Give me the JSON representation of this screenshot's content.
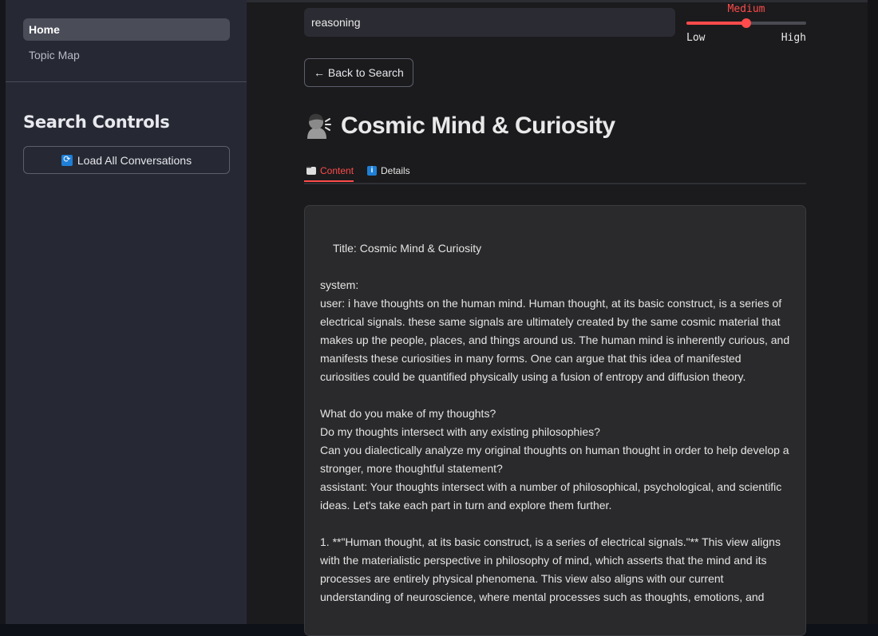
{
  "sidebar": {
    "nav": [
      {
        "label": "Home",
        "active": true
      },
      {
        "label": "Topic Map",
        "active": false
      }
    ],
    "heading": "Search Controls",
    "load_button_label": "Load All Conversations",
    "load_button_icon": "refresh-icon"
  },
  "search": {
    "value": "reasoning"
  },
  "slider": {
    "value_label": "Medium",
    "level": 0.5,
    "min_label": "Low",
    "max_label": "High",
    "accent_color": "#ff4b4b"
  },
  "back_button_label": "← Back to Search",
  "page": {
    "title": "Cosmic Mind & Curiosity",
    "icon": "person-thinking-icon"
  },
  "tabs": [
    {
      "label": "Content",
      "icon": "speech-bubble-icon",
      "active": true
    },
    {
      "label": "Details",
      "icon": "info-icon",
      "active": false
    }
  ],
  "content": {
    "title_line": "Title: Cosmic Mind & Curiosity",
    "system_line": "system:",
    "user_line": "user: i have thoughts on the human mind.  Human thought, at its basic construct, is a series of electrical signals. these same signals are ultimately created by the same cosmic material that makes up the people, places, and things around us. The human mind is inherently curious, and manifests these curiosities in many forms. One can argue that this idea of manifested curiosities could be quantified physically using a fusion of entropy and diffusion theory.",
    "q1": "What do you make of my thoughts?",
    "q2": "Do my thoughts intersect with any existing philosophies?",
    "q3": "Can you dialectically analyze my original thoughts on human thought in order to help develop a stronger, more thoughtful statement?",
    "assistant_line": "assistant: Your thoughts intersect with a number of philosophical, psychological, and scientific ideas. Let's take each part in turn and explore them further.",
    "point1": "1. **\"Human thought, at its basic construct, is a series of electrical signals.\"** This view aligns with the materialistic perspective in philosophy of mind, which asserts that the mind and its processes are entirely physical phenomena. This view also aligns with our current understanding of neuroscience, where mental processes such as thoughts, emotions, and"
  }
}
